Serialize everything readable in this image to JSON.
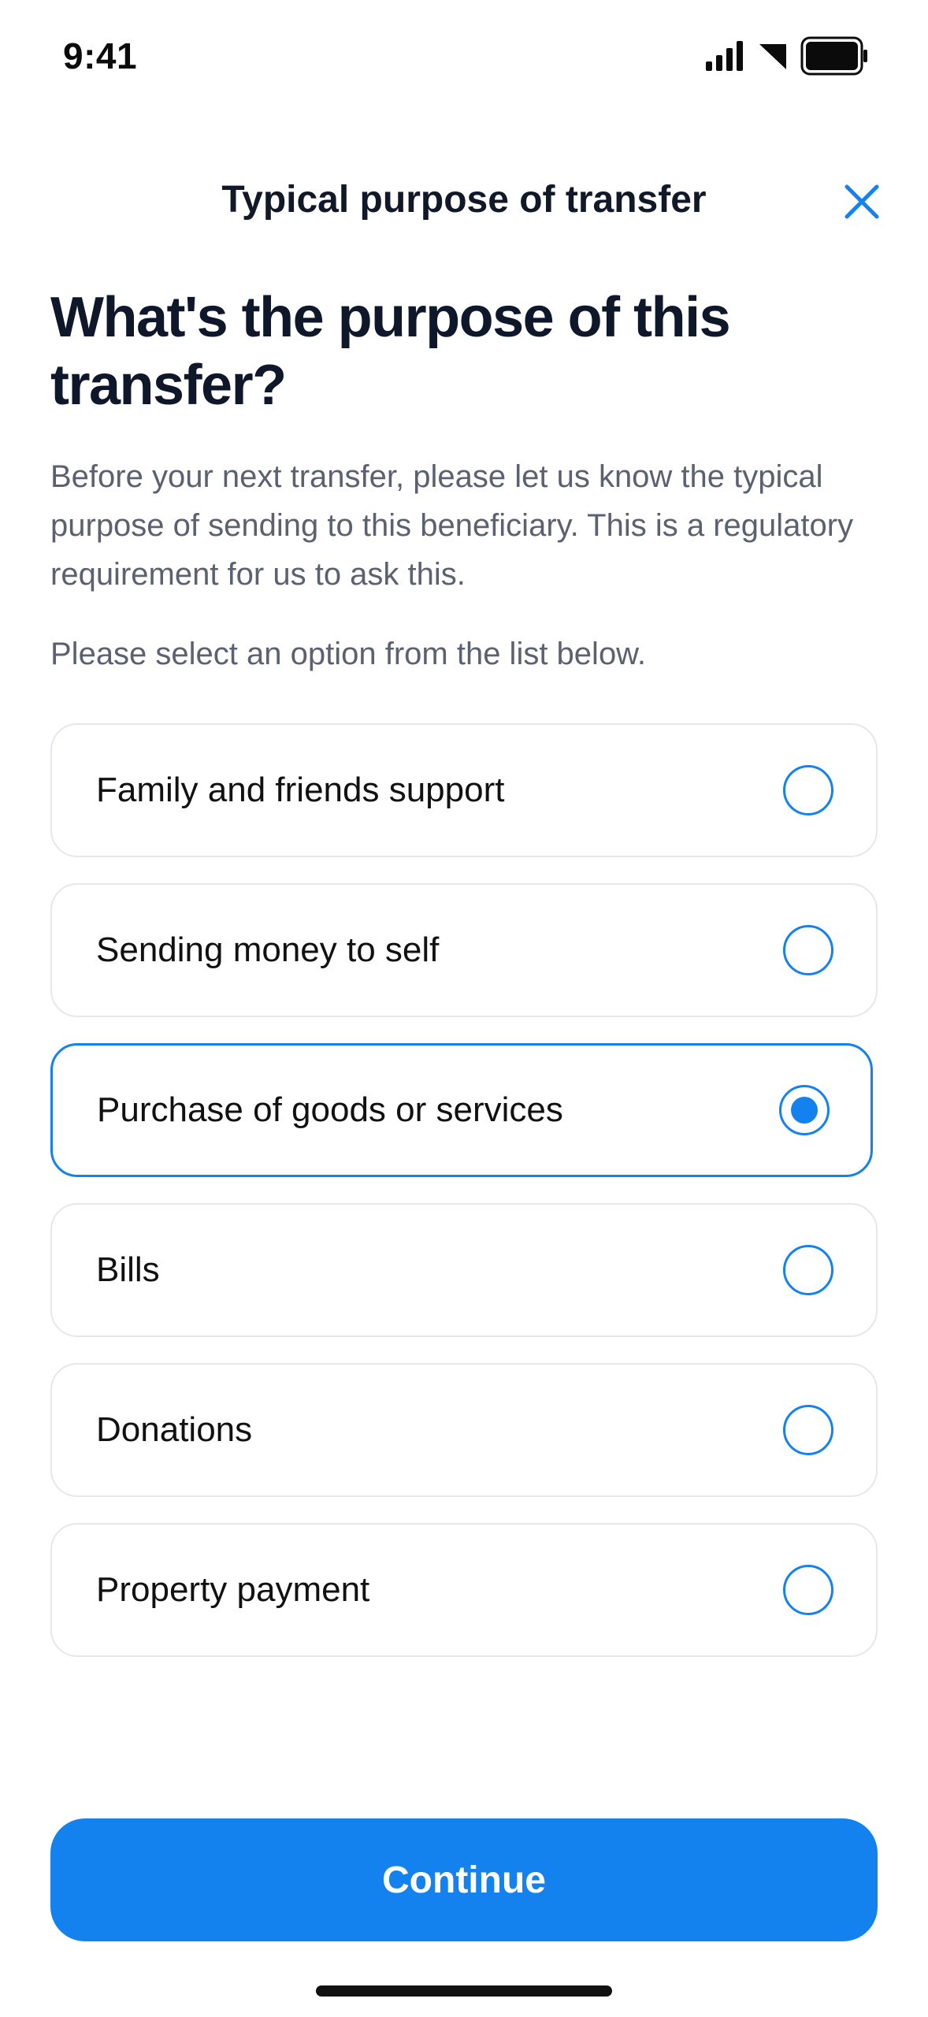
{
  "status_bar": {
    "time": "9:41",
    "icons": [
      "signal-icon",
      "wifi-icon",
      "battery-icon"
    ]
  },
  "header": {
    "title": "Typical purpose of transfer",
    "close_icon": "close-icon"
  },
  "main": {
    "heading": "What's the purpose of this transfer?",
    "intro": "Before your next transfer, please let us know the typical purpose of sending to this beneficiary. This is a regulatory requirement for us to ask this.",
    "instruction": "Please select an option from the list below.",
    "options": [
      {
        "label": "Family and friends support",
        "selected": false
      },
      {
        "label": "Sending money to self",
        "selected": false
      },
      {
        "label": "Purchase of goods or services",
        "selected": true
      },
      {
        "label": "Bills",
        "selected": false
      },
      {
        "label": "Donations",
        "selected": false
      },
      {
        "label": "Property payment",
        "selected": false
      }
    ]
  },
  "footer": {
    "continue_label": "Continue"
  },
  "colors": {
    "accent": "#1382EE",
    "border": "#E5E7EB",
    "text_primary": "#0F172A",
    "text_secondary": "#5B6170"
  }
}
